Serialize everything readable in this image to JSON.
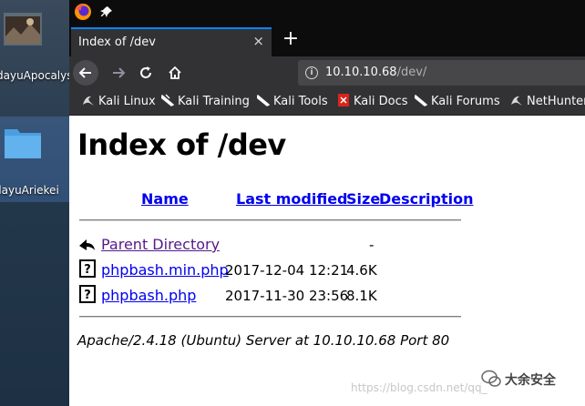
{
  "desktop": {
    "items": [
      {
        "label": "dayuApocalyst"
      },
      {
        "label": "dayuAriekei"
      }
    ]
  },
  "browser": {
    "tab_title": "Index of /dev",
    "tab_close": "×",
    "new_tab": "+",
    "url": {
      "host": "10.10.10.68",
      "path": "/dev/"
    },
    "bookmarks": [
      {
        "label": "Kali Linux"
      },
      {
        "label": "Kali Training"
      },
      {
        "label": "Kali Tools"
      },
      {
        "label": "Kali Docs"
      },
      {
        "label": "Kali Forums"
      },
      {
        "label": "NetHunter"
      }
    ]
  },
  "page": {
    "heading": "Index of /dev",
    "columns": {
      "name": "Name",
      "last_modified": "Last modified",
      "size": "Size",
      "description": "Description"
    },
    "parent": {
      "name": "Parent Directory",
      "size": "-"
    },
    "rows": [
      {
        "name": "phpbash.min.php",
        "modified": "2017-12-04 12:21",
        "size": "4.6K"
      },
      {
        "name": "phpbash.php",
        "modified": "2017-11-30 23:56",
        "size": "8.1K"
      }
    ],
    "address": "Apache/2.4.18 (Ubuntu) Server at 10.10.10.68 Port 80"
  },
  "watermark": {
    "url": "https://blog.csdn.net/qq_",
    "badge": "大余安全"
  }
}
